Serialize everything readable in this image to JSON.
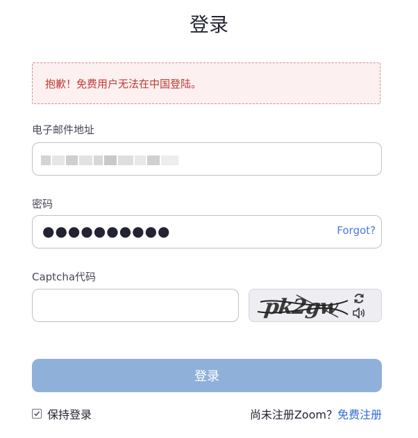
{
  "page": {
    "title": "登录"
  },
  "error": {
    "message": "抱歉！免费用户无法在中国登陆。"
  },
  "email": {
    "label": "电子邮件地址"
  },
  "password": {
    "label": "密码",
    "masked_value": "●●●●●●●●●●",
    "forgot_label": "Forgot?"
  },
  "captcha": {
    "label": "Captcha代码",
    "image_text": "pk2gw",
    "refresh_icon": "refresh-icon",
    "audio_icon": "audio-icon"
  },
  "submit": {
    "label": "登录"
  },
  "remember": {
    "label": "保持登录",
    "checked": true
  },
  "signup": {
    "prompt": "尚未注册Zoom？",
    "link": "免费注册"
  },
  "colors": {
    "accent": "#2d6ad9",
    "button_disabled": "#8fb0d9",
    "error_text": "#bd3b33",
    "error_bg": "#fdf0f0"
  }
}
